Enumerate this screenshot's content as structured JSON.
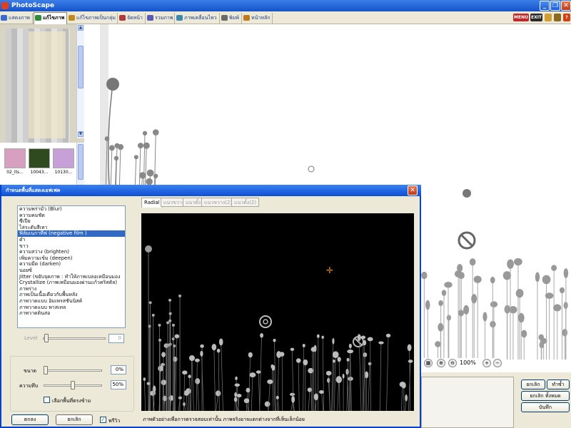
{
  "app": {
    "title": "PhotoScape"
  },
  "main_tabs": [
    {
      "label": "แสดงภาพ",
      "color": "#3a6ad0"
    },
    {
      "label": "แก้ไขภาพ",
      "color": "#2f8a3a"
    },
    {
      "label": "แก้ไขภาพเป็นกลุ่ม",
      "color": "#c08a1a"
    },
    {
      "label": "จัดหน้า",
      "color": "#b03a3a"
    },
    {
      "label": "รวมภาพ",
      "color": "#5a5ab8"
    },
    {
      "label": "ภาพเคลื่อนไหว",
      "color": "#3a8ab0"
    },
    {
      "label": "พิมพ์",
      "color": "#6a6a6a"
    },
    {
      "label": "หน้าหลัก",
      "color": "#c07a1a"
    }
  ],
  "top_icons": {
    "menu": "MENU",
    "exit": "EXIT"
  },
  "thumbnails": [
    {
      "label": "02_its...",
      "color": "#d8a0c0"
    },
    {
      "label": "10043...",
      "color": "#304a20"
    },
    {
      "label": "10130...",
      "color": "#c8a0d8"
    }
  ],
  "zoom": {
    "value": "100%"
  },
  "right_buttons": {
    "undo": "ยกเลิก",
    "redo": "ทำซ้ำ",
    "undo_all": "ยกเลิก ทั้งหมด",
    "save": "บันทึก"
  },
  "dialog": {
    "title": "กำหนดพื้นที่แสดงเอฟเฟค",
    "effects": [
      "ความพร่ามัว (Blur)",
      "ความคมชัด",
      "ซีเปีย",
      "ไล่ระดับสีเทา",
      "ฟิล์มเนกาทีฟ (negative film )",
      "ดำ",
      "ขาว",
      "ความสว่าง (brighten)",
      "เพิ่มความเข้ม (deepen)",
      "ความมืด (darken)",
      "นอยซ์",
      "Jitter (ขยับจุดภาพ : ทำให้ภาพเบลอเหมือนมอง",
      "Crystallize (ภาพเหมือนมองผ่านแก้วคริสตัล)",
      "ภาพร่าง",
      "ภาพเป็นเนื้อเดียวกับพื้นหลัง",
      "ภาพวาดแบบ อิมเพรสชันนิสต์",
      "ภาพวาดแบบ พาสเทล",
      "ภาพวาดดินสอ"
    ],
    "selected_index": 4,
    "level_label": "Level",
    "level_value": "0",
    "size_label": "ขนาด",
    "size_value": "0%",
    "size_level": 0,
    "opacity_label": "ความทึบ",
    "opacity_value": "50%",
    "opacity_level": 0.5,
    "invert_label": "เลือกพื้นที่ตรงข้าม",
    "ok_label": "ตกลง",
    "cancel_label": "ยกเลิก",
    "preview_label": "พรีวิว",
    "preview_checked": true,
    "preview_tabs": [
      "Radial",
      "แนวขวาง",
      "แนวตั้ง",
      "แนวขวาง(2)",
      "แนวตั้ง(2)"
    ],
    "note": "ภาพตัวอย่างเพื่อการตรวจสอบเท่านั้น ภาพจริงอาจแตกต่างจากที่เห็นเล็กน้อย"
  }
}
